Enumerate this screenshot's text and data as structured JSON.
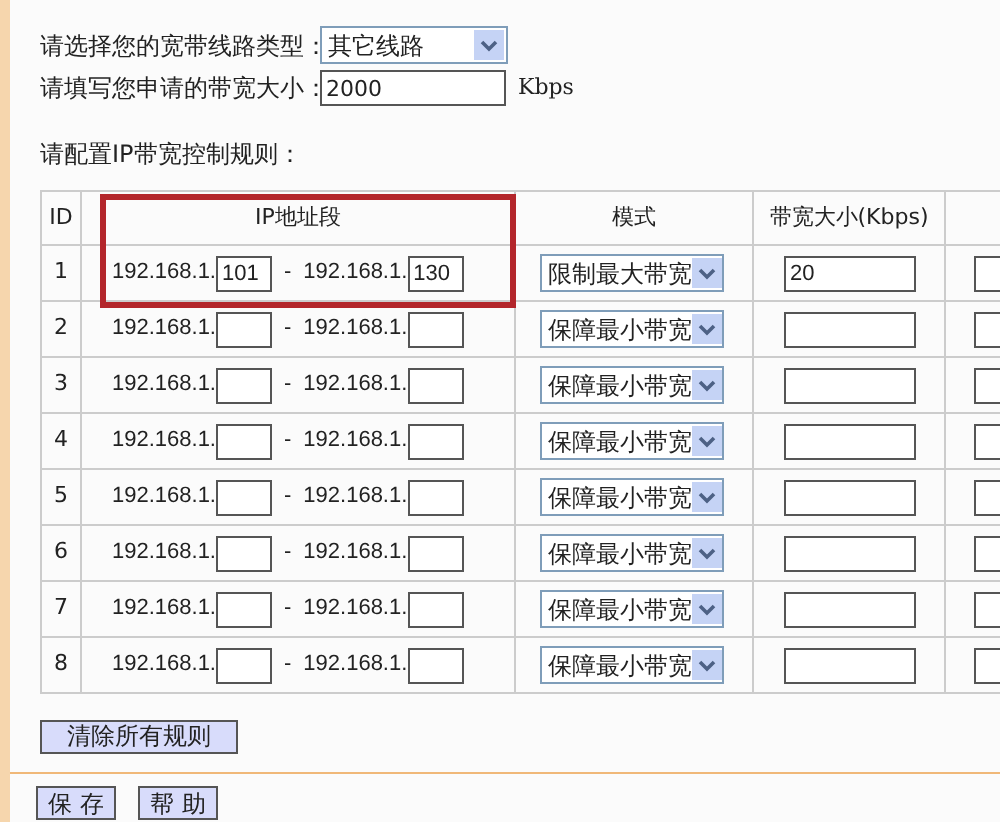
{
  "line_type": {
    "label": "请选择您的宽带线路类型：",
    "value": "其它线路"
  },
  "bandwidth": {
    "label": "请填写您申请的带宽大小：",
    "value": "2000",
    "unit": "Kbps"
  },
  "rules_title": "请配置IP带宽控制规则：",
  "table": {
    "highlight_frame": true,
    "columns": [
      "ID",
      "IP地址段",
      "模式",
      "带宽大小(Kbps)"
    ],
    "rows": [
      {
        "id": "1",
        "start_prefix": "192.168.1.",
        "start": "101",
        "dash": "-",
        "end_prefix": "192.168.1.",
        "end": "130",
        "mode": "限制最大带宽",
        "bandwidth": "20"
      },
      {
        "id": "2",
        "start_prefix": "192.168.1.",
        "dash": "-",
        "end_prefix": "192.168.1.",
        "mode": "保障最小带宽"
      },
      {
        "id": "3",
        "start_prefix": "192.168.1.",
        "dash": "-",
        "end_prefix": "192.168.1.",
        "mode": "保障最小带宽"
      },
      {
        "id": "4",
        "start_prefix": "192.168.1.",
        "dash": "-",
        "end_prefix": "192.168.1.",
        "mode": "保障最小带宽"
      },
      {
        "id": "5",
        "start_prefix": "192.168.1.",
        "dash": "-",
        "end_prefix": "192.168.1.",
        "mode": "保障最小带宽"
      },
      {
        "id": "6",
        "start_prefix": "192.168.1.",
        "dash": "-",
        "end_prefix": "192.168.1.",
        "mode": "保障最小带宽"
      },
      {
        "id": "7",
        "start_prefix": "192.168.1.",
        "dash": "-",
        "end_prefix": "192.168.1.",
        "mode": "保障最小带宽"
      },
      {
        "id": "8",
        "start_prefix": "192.168.1.",
        "dash": "-",
        "end_prefix": "192.168.1.",
        "mode": "保障最小带宽"
      }
    ]
  },
  "clear_button": "清除所有规则",
  "buttons": [
    "保 存",
    "帮 助"
  ]
}
